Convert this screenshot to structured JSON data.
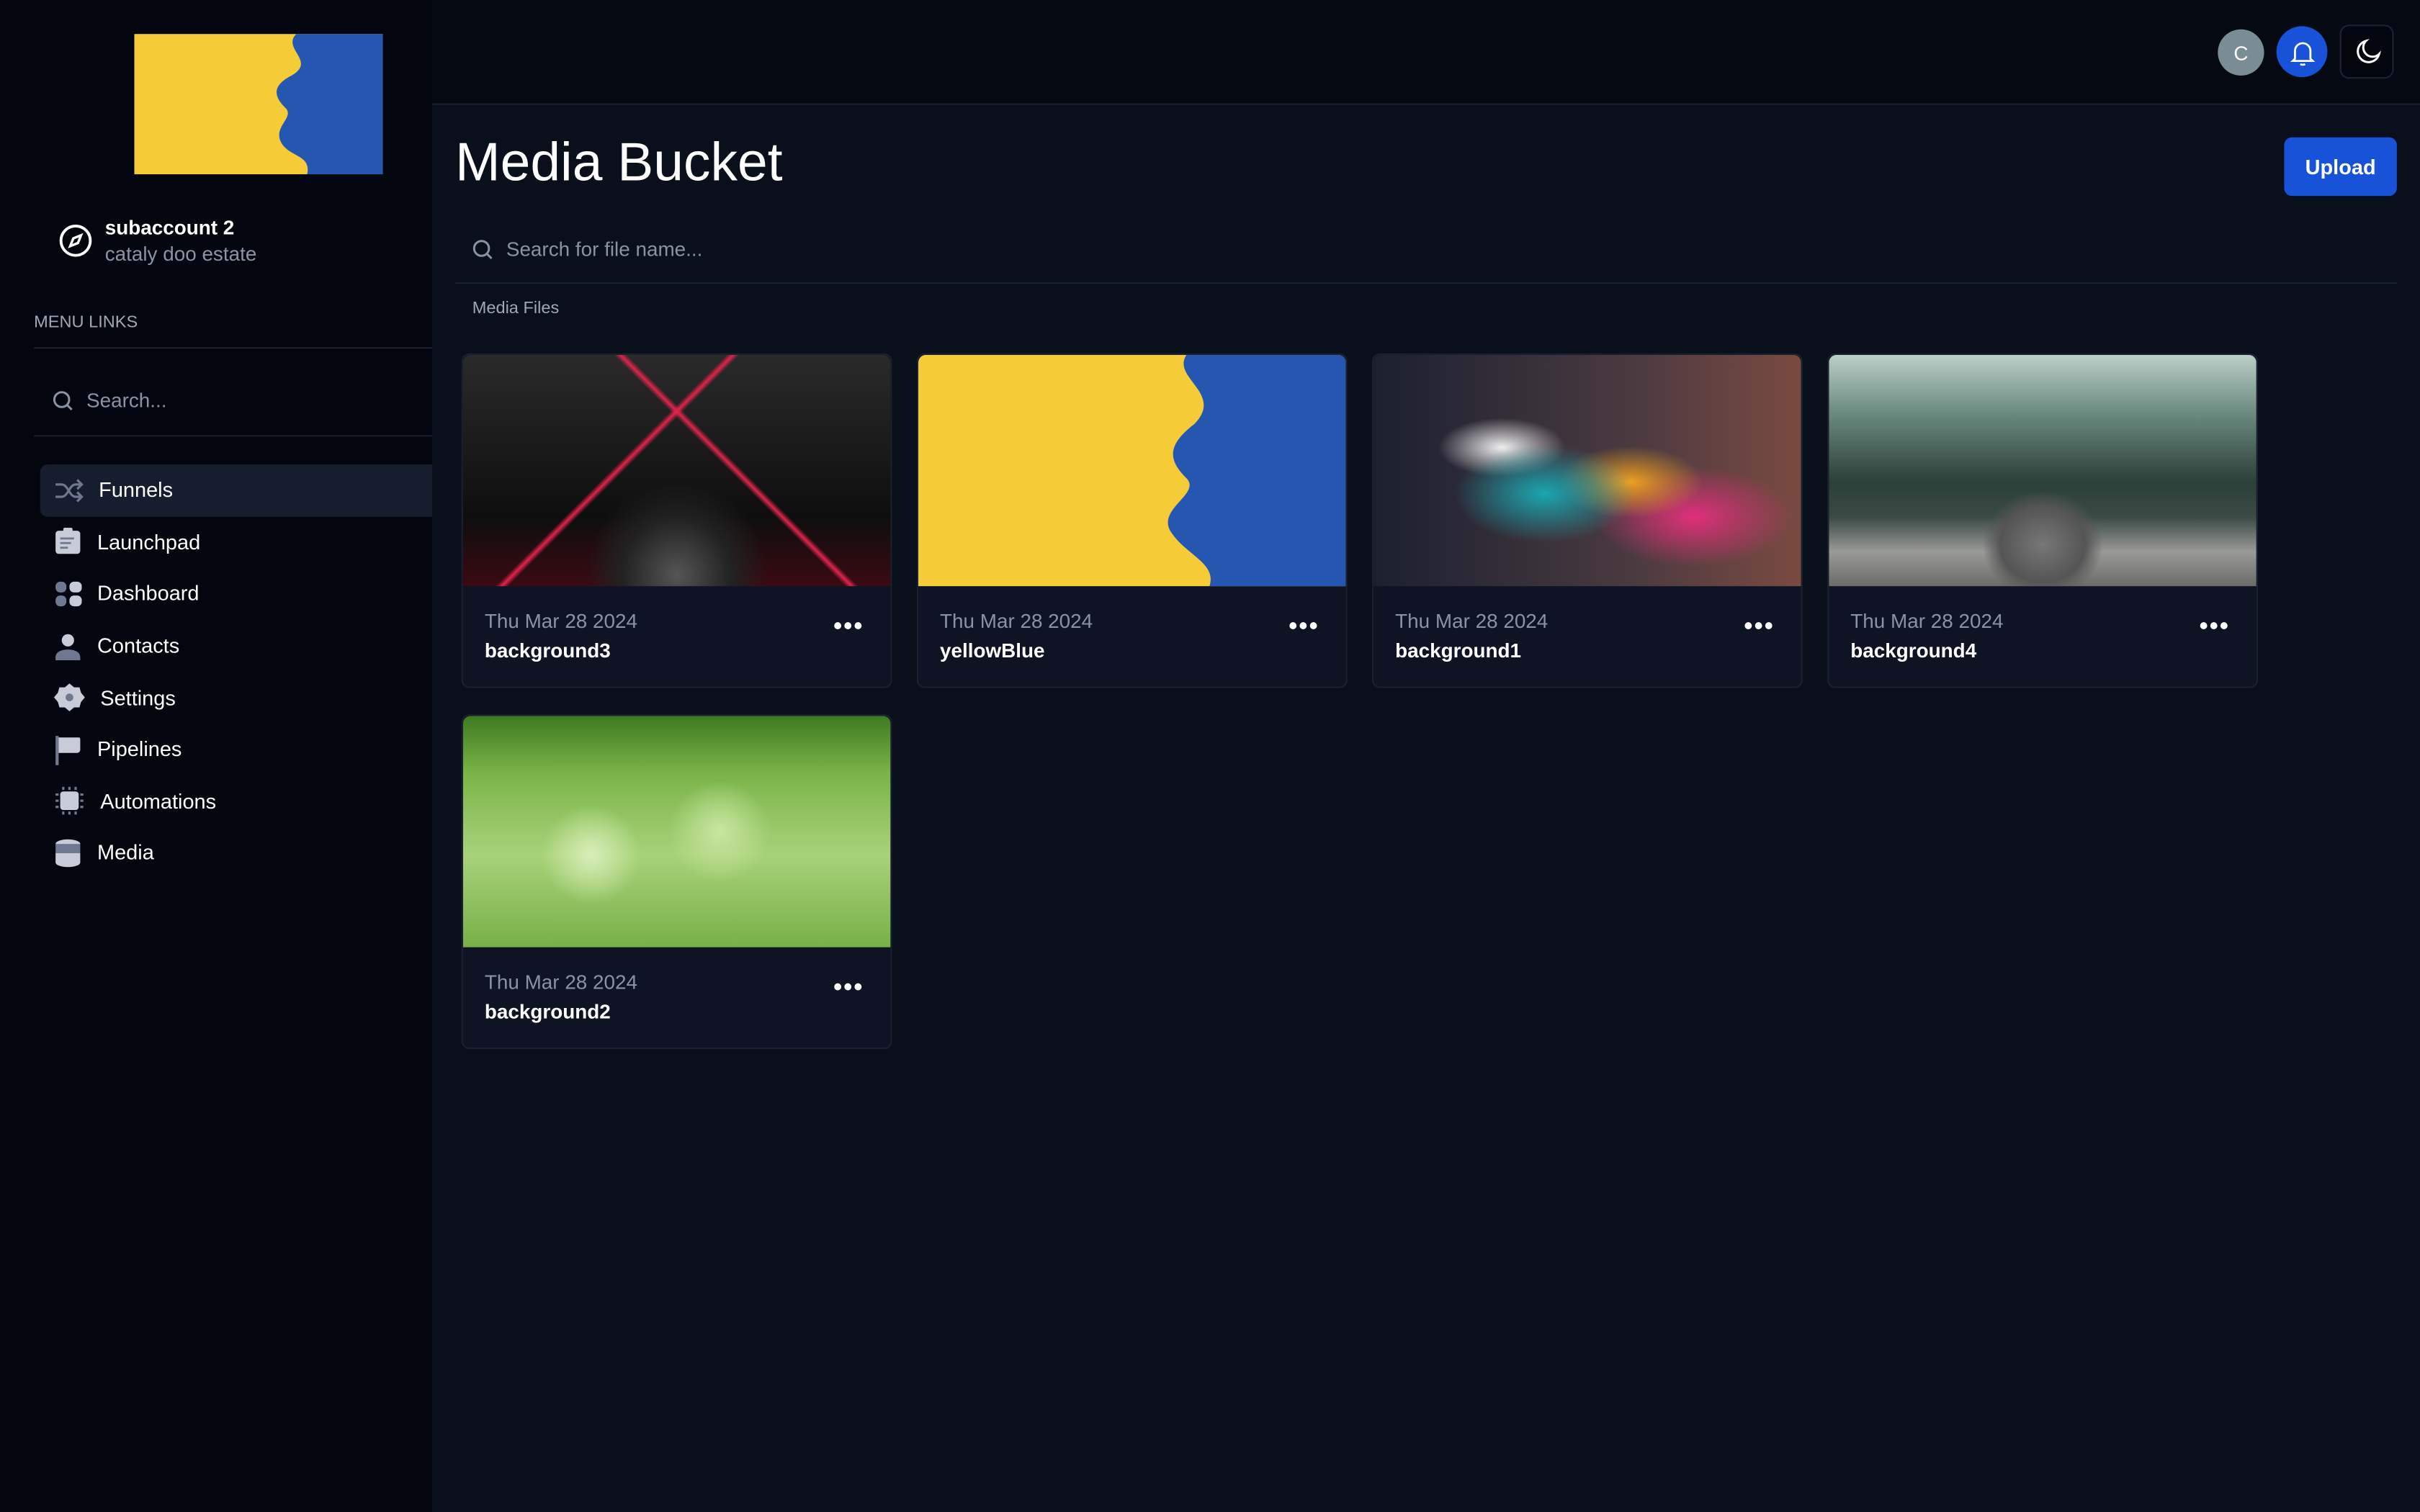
{
  "sidebar": {
    "account_name": "subaccount 2",
    "account_sub": "cataly doo estate",
    "menu_heading": "MENU LINKS",
    "search_placeholder": "Search...",
    "items": [
      {
        "label": "Funnels",
        "icon": "shuffle-icon",
        "active": true
      },
      {
        "label": "Launchpad",
        "icon": "clipboard-icon"
      },
      {
        "label": "Dashboard",
        "icon": "grid-icon"
      },
      {
        "label": "Contacts",
        "icon": "user-icon"
      },
      {
        "label": "Settings",
        "icon": "gear-icon"
      },
      {
        "label": "Pipelines",
        "icon": "flag-icon"
      },
      {
        "label": "Automations",
        "icon": "chip-icon"
      },
      {
        "label": "Media",
        "icon": "database-icon"
      }
    ]
  },
  "header": {
    "avatar_initial": "C"
  },
  "main": {
    "title": "Media Bucket",
    "upload_label": "Upload",
    "search_placeholder": "Search for file name...",
    "section_label": "Media Files",
    "files": [
      {
        "date": "Thu Mar 28 2024",
        "name": "background3"
      },
      {
        "date": "Thu Mar 28 2024",
        "name": "yellowBlue"
      },
      {
        "date": "Thu Mar 28 2024",
        "name": "background1"
      },
      {
        "date": "Thu Mar 28 2024",
        "name": "background4"
      },
      {
        "date": "Thu Mar 28 2024",
        "name": "background2"
      }
    ],
    "more_label": "•••"
  },
  "colors": {
    "accent": "#1752d8",
    "sidebar_bg": "#03060e",
    "main_bg": "#0a0f1c"
  }
}
